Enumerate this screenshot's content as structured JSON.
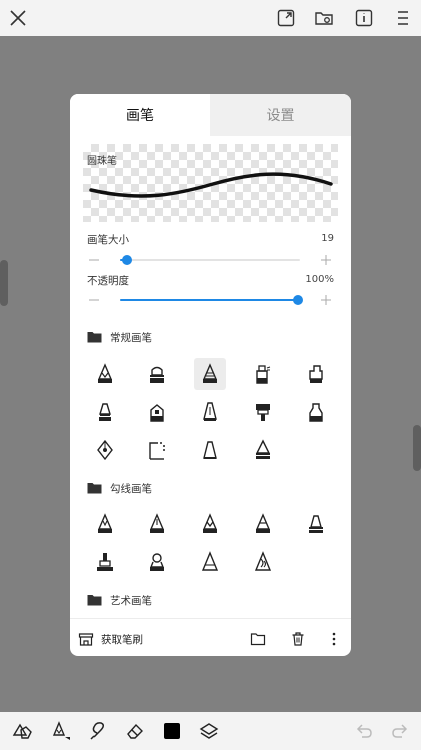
{
  "topbar": {
    "icons": [
      "close-icon",
      "fullscreen-icon",
      "folder-settings-icon",
      "info-icon",
      "menu-icon"
    ]
  },
  "panel": {
    "tabs": [
      {
        "label": "画笔",
        "active": true
      },
      {
        "label": "设置",
        "active": false
      }
    ],
    "preview_label": "圆珠笔",
    "size": {
      "label": "画笔大小",
      "value": "19",
      "fraction": 0.04
    },
    "opacity": {
      "label": "不透明度",
      "value": "100%",
      "fraction": 1.0
    },
    "sections": [
      {
        "name": "常规画笔",
        "brushes": [
          "pencil-brush-icon",
          "marker-brush-icon",
          "airbrush-brush-icon",
          "spray-brush-icon",
          "wide-marker-brush-icon",
          "flat-pen-brush-icon",
          "stamp-brush-icon",
          "chisel-brush-icon",
          "paint-brush-icon",
          "bottle-brush-icon",
          "fountain-pen-brush-icon",
          "dotted-corner-brush-icon",
          "cone-brush-icon",
          "round-marker-brush-icon"
        ],
        "selected_index": 2
      },
      {
        "name": "勾线画笔",
        "brushes": [
          "fine-liner-brush-icon",
          "ink-liner-brush-icon",
          "bold-liner-brush-icon",
          "striped-liner-brush-icon",
          "cap-liner-brush-icon",
          "seal-liner-brush-icon",
          "bulb-liner-brush-icon",
          "triangle-liner-brush-icon",
          "pattern-liner-brush-icon"
        ]
      },
      {
        "name": "艺术画笔",
        "brushes": []
      }
    ],
    "footer": {
      "get_brushes_label": "获取笔刷",
      "icons": [
        "store-icon",
        "folder-icon",
        "trash-icon",
        "more-vertical-icon"
      ]
    }
  },
  "toolbar": {
    "icons": [
      "shapes-icon",
      "pen-tool-icon",
      "lasso-icon",
      "eraser-icon",
      "color-swatch-icon",
      "layers-icon",
      "undo-icon",
      "redo-icon"
    ],
    "color": "#000000"
  },
  "colors": {
    "accent": "#1e88e5",
    "backdrop": "#808080"
  }
}
